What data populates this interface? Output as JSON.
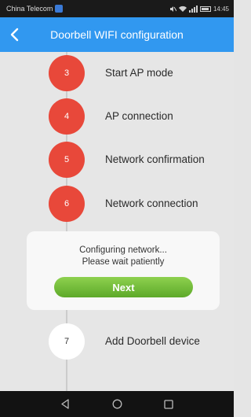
{
  "statusbar": {
    "carrier": "China Telecom",
    "time": "14:45"
  },
  "header": {
    "title": "Doorbell WIFI configuration",
    "back_icon": "chevron-left-icon"
  },
  "steps": [
    {
      "number": "3",
      "label": "Start AP mode",
      "state": "done"
    },
    {
      "number": "4",
      "label": "AP connection",
      "state": "done"
    },
    {
      "number": "5",
      "label": "Network confirmation",
      "state": "done"
    },
    {
      "number": "6",
      "label": "Network connection",
      "state": "done"
    },
    {
      "number": "7",
      "label": "Add Doorbell device",
      "state": "pending"
    }
  ],
  "dialog": {
    "line1": "Configuring network...",
    "line2": "Please wait patiently",
    "next_label": "Next"
  },
  "colors": {
    "accent": "#3198f0",
    "step_active": "#e8483a",
    "button_green": "#6cbf35"
  },
  "navbar": {
    "icons": [
      "back-triangle-icon",
      "home-circle-icon",
      "recents-square-icon"
    ]
  }
}
